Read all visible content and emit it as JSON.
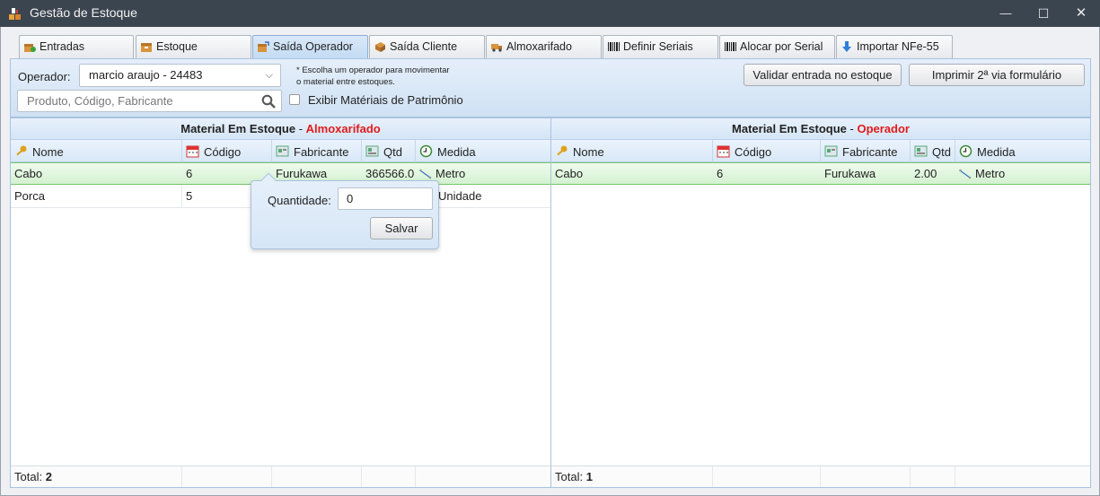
{
  "window": {
    "title": "Gestão de Estoque",
    "minimize": "—",
    "maximize": "☐",
    "close": "✕"
  },
  "tabs": [
    {
      "label": "Entradas",
      "icon": "box-add-icon"
    },
    {
      "label": "Estoque",
      "icon": "box-icon"
    },
    {
      "label": "Saída Operador",
      "icon": "box-out-icon",
      "active": true
    },
    {
      "label": "Saída Cliente",
      "icon": "box-send-icon"
    },
    {
      "label": "Almoxarifado",
      "icon": "truck-icon"
    },
    {
      "label": "Definir Seriais",
      "icon": "barcode-icon"
    },
    {
      "label": "Alocar por Serial",
      "icon": "barcode-icon"
    },
    {
      "label": "Importar NFe-55",
      "icon": "download-arrow-icon"
    }
  ],
  "toolbar": {
    "operator_label": "Operador:",
    "operator_value": "marcio araujo - 24483",
    "hint_line1": "* Escolha um operador para movimentar",
    "hint_line2": "o material entre estoques.",
    "search_placeholder": "Produto, Código, Fabricante",
    "checkbox_label": "Exibir Matériais de Patrimônio",
    "validate_button": "Validar entrada no estoque",
    "print_button": "Imprimir 2ª via formulário"
  },
  "left_grid": {
    "title_prefix": "Material Em Estoque",
    "title_sep": " - ",
    "title_highlight": "Almoxarifado",
    "columns": [
      "Nome",
      "Código",
      "Fabricante",
      "Qtd",
      "Medida"
    ],
    "rows": [
      {
        "nome": "Cabo",
        "codigo": "6",
        "fabricante": "Furukawa",
        "qtd": "366566.0",
        "medida": "Metro"
      },
      {
        "nome": "Porca",
        "codigo": "5",
        "fabricante": "",
        "qtd": "",
        "medida": "Unidade"
      }
    ],
    "total_label": "Total:",
    "total_value": "2"
  },
  "right_grid": {
    "title_prefix": "Material Em Estoque",
    "title_sep": " - ",
    "title_highlight": "Operador",
    "columns": [
      "Nome",
      "Código",
      "Fabricante",
      "Qtd",
      "Medida"
    ],
    "rows": [
      {
        "nome": "Cabo",
        "codigo": "6",
        "fabricante": "Furukawa",
        "qtd": "2.00",
        "medida": "Metro"
      }
    ],
    "total_label": "Total:",
    "total_value": "1"
  },
  "popover": {
    "quantity_label": "Quantidade:",
    "quantity_value": "0",
    "save_button": "Salvar"
  },
  "colors": {
    "highlight_red": "#e21b1b",
    "selected_row": "#d3f1d0",
    "panel_blue": "#d6e6f7",
    "titlebar": "#3b4550"
  }
}
